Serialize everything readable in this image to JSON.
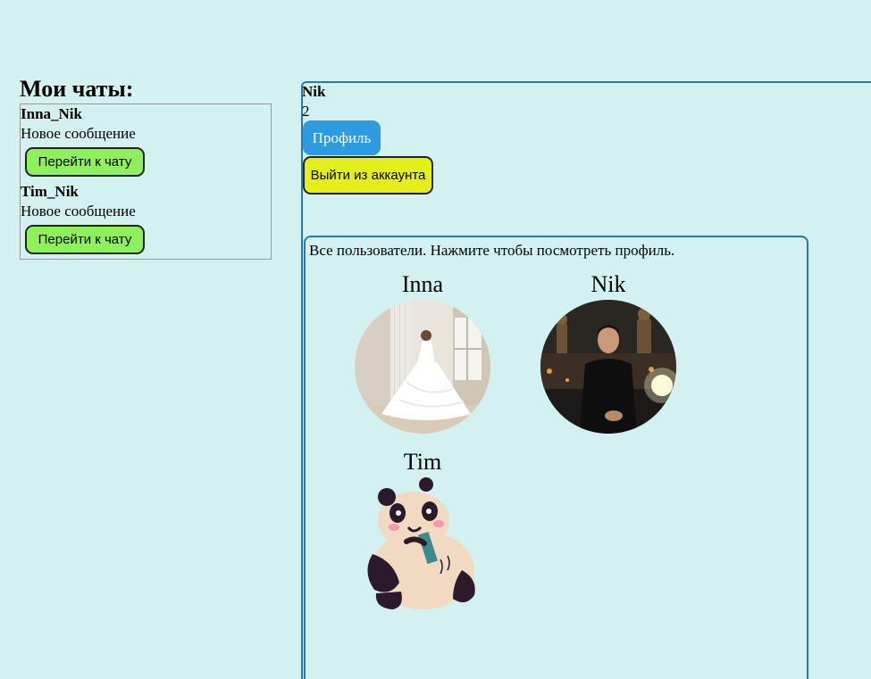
{
  "chats": {
    "title": "Мои чаты:",
    "items": [
      {
        "name": "Inna_Nik",
        "message": "Новое сообщение",
        "button": "Перейти к чату"
      },
      {
        "name": "Tim_Nik",
        "message": "Новое сообщение",
        "button": "Перейти к чату"
      }
    ]
  },
  "profile": {
    "name": "Nik",
    "count": "2",
    "profile_button": "Профиль",
    "logout_button": "Выйти из аккаунта"
  },
  "users": {
    "caption": "Все пользователи. Нажмите чтобы посмотреть профиль.",
    "list": [
      {
        "name": "Inna",
        "avatar": "wedding-photo"
      },
      {
        "name": "Nik",
        "avatar": "night-photo"
      },
      {
        "name": "Tim",
        "avatar": "panda-illustration"
      }
    ]
  },
  "colors": {
    "background": "#d2f1f0",
    "panel_border": "#2a78b6",
    "chat_button": "#8ef05a",
    "profile_button": "#2e9be0",
    "logout_button": "#e3ee1a"
  }
}
